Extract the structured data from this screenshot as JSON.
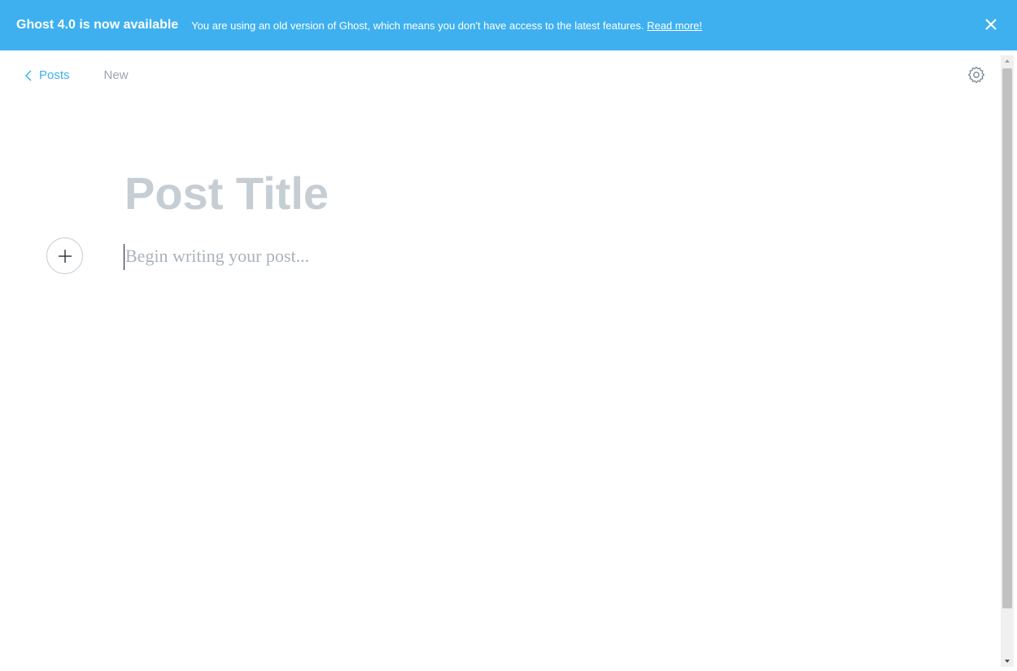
{
  "banner": {
    "title": "Ghost 4.0 is now available",
    "text_before": "You are using an old version of Ghost, which means you don't have access to the latest features. ",
    "link_label": "Read more!",
    "close_icon": "close-icon"
  },
  "header": {
    "back_label": "Posts",
    "status_label": "New",
    "back_icon": "chevron-left-icon",
    "settings_icon": "gear-icon"
  },
  "editor": {
    "title_placeholder": "Post Title",
    "body_placeholder": "Begin writing your post...",
    "plus_icon": "plus-icon"
  },
  "colors": {
    "accent": "#3eb0ef",
    "placeholder": "#c5ced4",
    "muted_text": "#9aa5ad"
  }
}
